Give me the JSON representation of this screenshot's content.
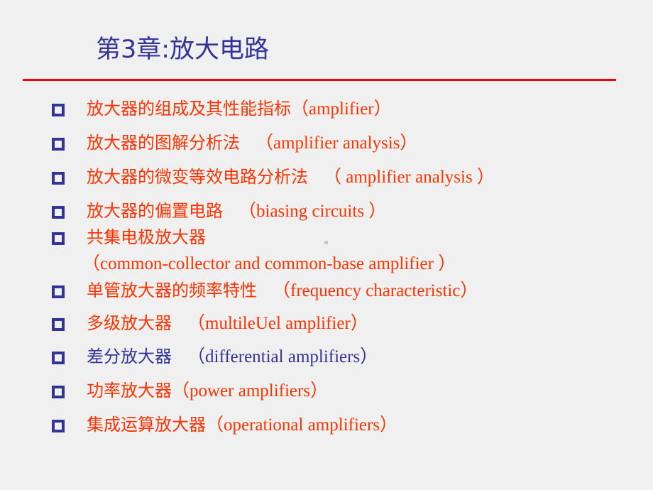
{
  "slide": {
    "title": "第3章:放大电路",
    "colors": {
      "title": "#333399",
      "rule": "#ff0000",
      "bullet": "#333399",
      "item_red": "#ff3300",
      "item_blue": "#333399",
      "background": "#f0f0f0"
    },
    "items": [
      {
        "zh": "放大器的组成及其性能指标",
        "en": "（amplifier）",
        "color": "red"
      },
      {
        "zh": "放大器的图解分析法",
        "en": "（amplifier analysis）",
        "color": "red"
      },
      {
        "zh": "放大器的微变等效电路分析法",
        "en": "（ amplifier analysis ）",
        "color": "red"
      },
      {
        "zh": "放大器的偏置电路",
        "en": "（biasing circuits ）",
        "color": "red"
      },
      {
        "zh": "共集电极放大器",
        "en": "",
        "continuation": "（common-collector and common-base amplifier ）",
        "color": "red"
      },
      {
        "zh": "单管放大器的频率特性",
        "en": "（frequency characteristic）",
        "color": "red"
      },
      {
        "zh": "多级放大器",
        "en": "（multileUel amplifier）",
        "color": "red"
      },
      {
        "zh": "差分放大器",
        "en": "（differential amplifiers）",
        "color": "blue"
      },
      {
        "zh": "功率放大器",
        "en": "（power amplifiers）",
        "color": "red"
      },
      {
        "zh": "集成运算放大器",
        "en": "（operational amplifiers）",
        "color": "red"
      }
    ]
  }
}
